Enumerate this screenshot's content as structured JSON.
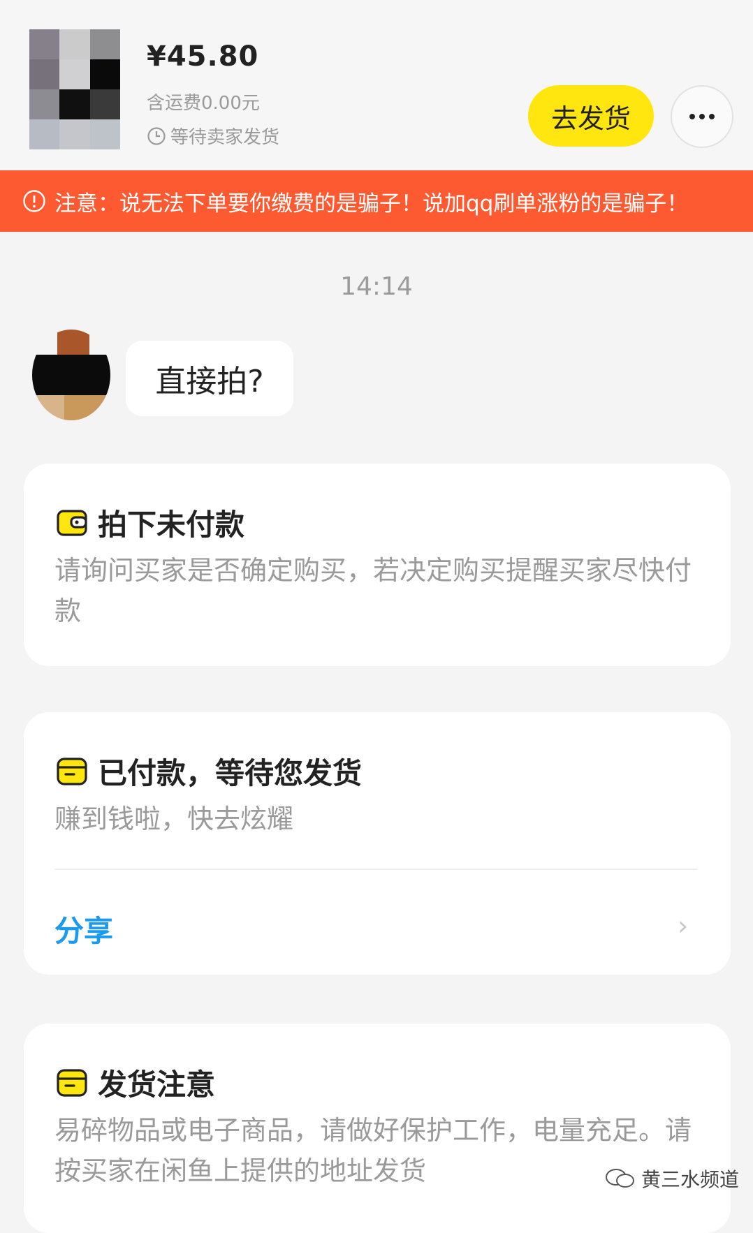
{
  "header": {
    "price": "¥45.80",
    "shipping": "含运费0.00元",
    "status": "等待卖家发货",
    "ship_button": "去发货",
    "thumb_colors": [
      "#85808a",
      "#cbcbcb",
      "#8e8e90",
      "#76717a",
      "#d0d0d2",
      "#0a0a0a",
      "#8d8c92",
      "#101010",
      "#3a3a3a",
      "#b7bcc4",
      "#c4c6cc",
      "#bdc3c9"
    ]
  },
  "warning": {
    "text": "注意：说无法下单要你缴费的是骗子！说加qq刷单涨粉的是骗子！",
    "color": "#fe5a32"
  },
  "chat": {
    "timestamp": "14:14",
    "message": "直接拍?"
  },
  "cards": [
    {
      "title": "拍下未付款",
      "icon": "wallet-icon",
      "desc": "请询问买家是否确定购买，若决定购买提醒买家尽快付款"
    },
    {
      "title": "已付款，等待您发货",
      "icon": "package-icon",
      "desc": "赚到钱啦，快去炫耀",
      "link": "分享"
    },
    {
      "title": "发货注意",
      "icon": "package-icon",
      "desc": "易碎物品或电子商品，请做好保护工作，电量充足。请按买家在闲鱼上提供的地址发货"
    }
  ],
  "watermark": "黄三水频道",
  "accent_yellow": "#ffe60f",
  "link_color": "#1a9bf0"
}
